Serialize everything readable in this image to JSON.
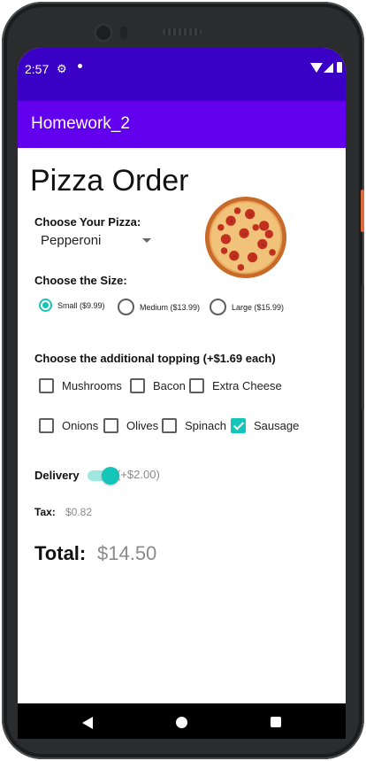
{
  "status_bar": {
    "time": "2:57",
    "icons": [
      "gear-icon",
      "dot-icon",
      "wifi-icon",
      "signal-icon",
      "battery-icon"
    ]
  },
  "app_bar": {
    "title": "Homework_2",
    "color": "#6200ee"
  },
  "page": {
    "heading": "Pizza Order"
  },
  "pizza": {
    "label": "Choose Your Pizza:",
    "selected": "Pepperoni"
  },
  "size": {
    "label": "Choose the Size:",
    "options": [
      "Small ($9.99)",
      "Medium ($13.99)",
      "Large ($15.99)"
    ],
    "selected": "Small ($9.99)"
  },
  "toppings": {
    "label": "Choose the additional topping (+$1.69 each)",
    "items": [
      "Mushrooms",
      "Bacon",
      "Extra Cheese",
      "Onions",
      "Olives",
      "Spinach",
      "Sausage"
    ],
    "checked": [
      "Sausage"
    ]
  },
  "delivery": {
    "label": "Delivery",
    "fee": "(+$2.00)",
    "enabled": true
  },
  "tax": {
    "label": "Tax:",
    "value": "$0.82"
  },
  "total": {
    "label": "Total:",
    "value": "$14.50"
  },
  "accent_color": "#14c6b9",
  "nav": {
    "icons": [
      "back-icon",
      "home-icon",
      "recents-icon"
    ]
  }
}
